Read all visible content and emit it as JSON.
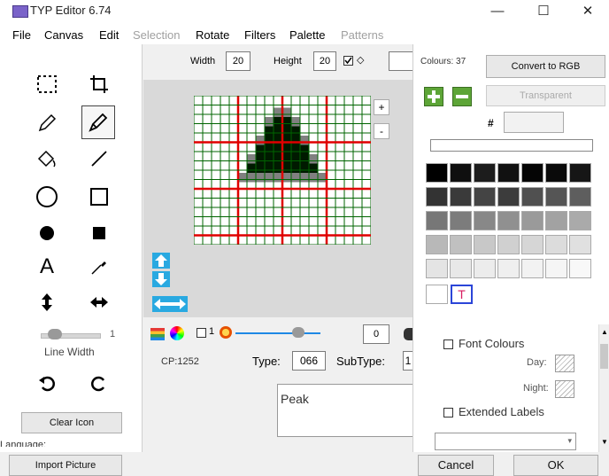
{
  "window": {
    "title": "TYP Editor 6.74",
    "minimize": "—",
    "maximize": "☐",
    "close": "✕"
  },
  "menu": [
    "File",
    "Canvas",
    "Edit",
    "Selection",
    "Rotate",
    "Filters",
    "Palette",
    "Patterns"
  ],
  "menu_disabled": [
    "Selection",
    "Patterns"
  ],
  "toolbar": {
    "width_label": "Width",
    "width_value": "20",
    "height_label": "Height",
    "height_value": "20"
  },
  "tools": {
    "slider_value": "1",
    "line_width_label": "Line Width",
    "clear_icon_label": "Clear Icon",
    "language_label": "Language:",
    "import_label": "Import Picture"
  },
  "canvas_tools": {
    "plus": "+",
    "minus": "-",
    "checkbox_value": "1",
    "slider_value": "0"
  },
  "info": {
    "cp_label": "CP:1252",
    "type_label": "Type:",
    "type_value": "066",
    "subtype_label": "SubType:",
    "subtype_value": "1",
    "label_text": "Peak"
  },
  "colours": {
    "count_label": "Colours: 37",
    "convert_button": "Convert to RGB",
    "transparent_button": "Transparent",
    "hash_label": "#",
    "selected_marker": "T",
    "font_colours_label": "Font Colours",
    "day_label": "Day:",
    "night_label": "Night:",
    "extended_labels_label": "Extended Labels",
    "palette_rows": [
      [
        "#000000",
        "#0f0f0f",
        "#1c1c1c",
        "#111111",
        "#050505",
        "#0a0a0a",
        "#161616"
      ],
      [
        "#333333",
        "#3a3a3a",
        "#444444",
        "#3c3c3c",
        "#505050",
        "#555555",
        "#5e5e5e"
      ],
      [
        "#777777",
        "#7c7c7c",
        "#888888",
        "#909090",
        "#9a9a9a",
        "#a2a2a2",
        "#aaaaaa"
      ],
      [
        "#b8b8b8",
        "#c0c0c0",
        "#c8c8c8",
        "#d0d0d0",
        "#d6d6d6",
        "#dcdcdc",
        "#e0e0e0"
      ],
      [
        "#e4e4e4",
        "#e8e8e8",
        "#ececec",
        "#efefef",
        "#f2f2f2",
        "#f5f5f5",
        "#f8f8f8"
      ]
    ]
  },
  "footer": {
    "cancel": "Cancel",
    "ok": "OK"
  },
  "icon_grid": {
    "major_line_color": "#e00000",
    "minor_line_color": "#006400",
    "fill_dark": "#001a00",
    "fill_gray": "#808080"
  }
}
